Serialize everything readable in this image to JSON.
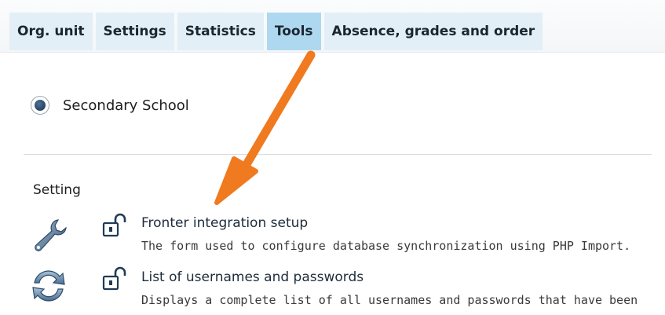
{
  "tabs": [
    {
      "label": "Org. unit",
      "active": false
    },
    {
      "label": "Settings",
      "active": false
    },
    {
      "label": "Statistics",
      "active": false
    },
    {
      "label": "Tools",
      "active": true
    },
    {
      "label": "Absence, grades and order",
      "active": false
    }
  ],
  "org_unit": {
    "label": "Secondary School",
    "selected": true
  },
  "section": {
    "title": "Setting"
  },
  "tools": [
    {
      "title": "Fronter integration setup",
      "description": "The form used to configure database synchronization using PHP Import.",
      "icon": "wrench-icon",
      "access_icon": "unlock-icon"
    },
    {
      "title": "List of usernames and passwords",
      "description": "Displays a complete list of all usernames and passwords that have been",
      "icon": "sync-icon",
      "access_icon": "unlock-icon"
    }
  ],
  "colors": {
    "tab_bg": "#e3eff7",
    "tab_active_bg": "#aed8f0",
    "annotation_arrow": "#f07a1f"
  }
}
